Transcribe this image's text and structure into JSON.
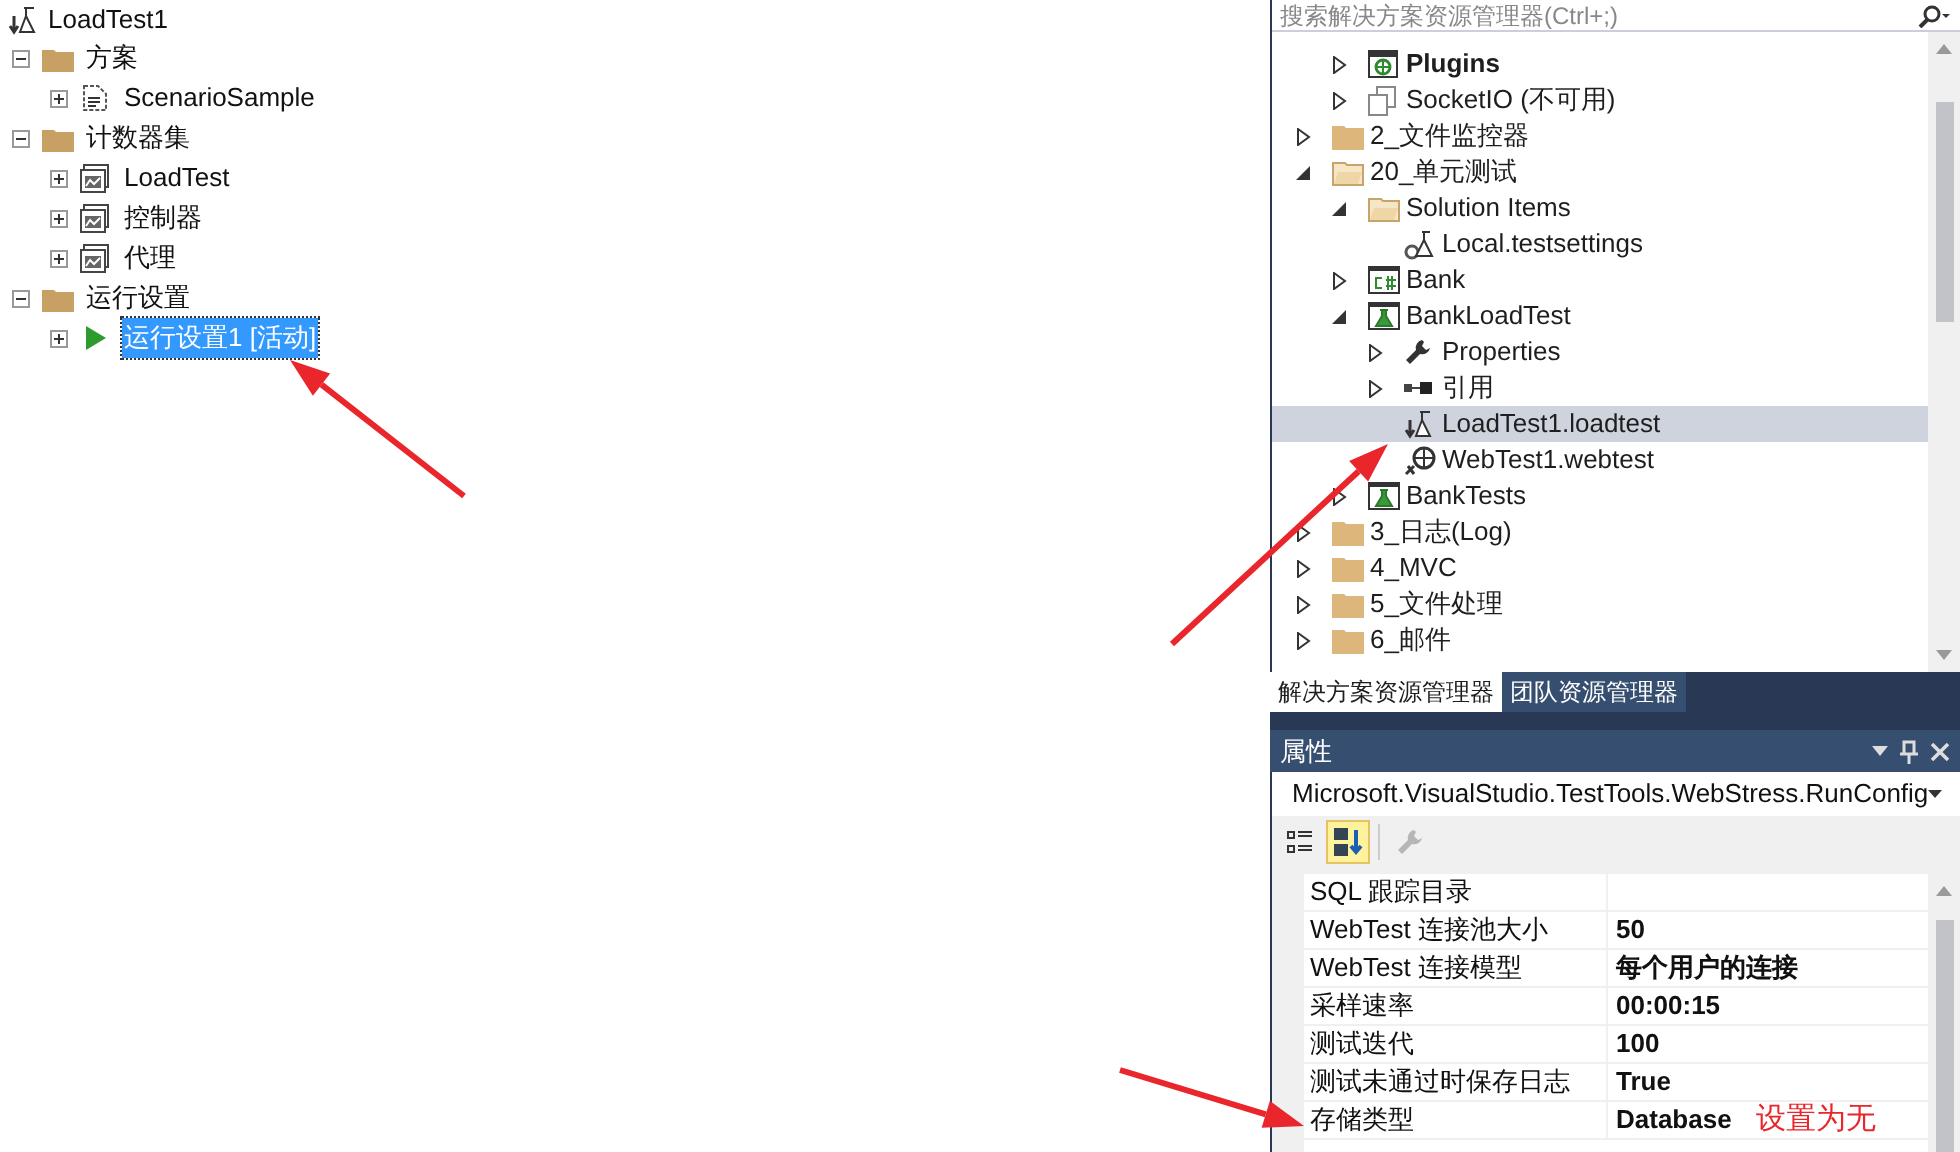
{
  "load_test_tree": {
    "label": "LoadTest1",
    "children": [
      {
        "label": "方案",
        "kind": "folder",
        "expanded": true,
        "children": [
          {
            "label": "ScenarioSample",
            "kind": "scenario",
            "expanded": false,
            "selected": false
          }
        ]
      },
      {
        "label": "计数器集",
        "kind": "folder",
        "expanded": true,
        "children": [
          {
            "label": "LoadTest",
            "kind": "counter",
            "expanded": false,
            "selected": false
          },
          {
            "label": "控制器",
            "kind": "counter",
            "expanded": false,
            "selected": false
          },
          {
            "label": "代理",
            "kind": "counter",
            "expanded": false,
            "selected": false
          }
        ]
      },
      {
        "label": "运行设置",
        "kind": "folder",
        "expanded": true,
        "children": [
          {
            "label": "运行设置1 [活动]",
            "kind": "run",
            "expanded": false,
            "selected": true
          }
        ]
      }
    ]
  },
  "solution_explorer": {
    "search": {
      "placeholder": "搜索解决方案资源管理器(Ctrl+;)"
    },
    "nested_items": [
      {
        "label": "Plugins",
        "kind": "web",
        "expanded": false,
        "bold": true,
        "selected": false
      },
      {
        "label": "SocketIO (不可用)",
        "kind": "unavailable",
        "expanded": false,
        "bold": false,
        "selected": false
      }
    ],
    "items": [
      {
        "label": "2_文件监控器",
        "kind": "folder",
        "expanded": false,
        "bold": false,
        "selected": false
      },
      {
        "label": "20_单元测试",
        "kind": "open-folder",
        "expanded": true,
        "bold": false,
        "selected": false,
        "children": [
          {
            "label": "Solution Items",
            "kind": "open-folder",
            "expanded": true,
            "bold": false,
            "selected": false,
            "children": [
              {
                "label": "Local.testsettings",
                "kind": "settings",
                "bold": false,
                "selected": false
              }
            ]
          },
          {
            "label": "Bank",
            "kind": "csharp",
            "expanded": false,
            "bold": false,
            "selected": false
          },
          {
            "label": "BankLoadTest",
            "kind": "test-project",
            "expanded": true,
            "bold": false,
            "selected": false,
            "children": [
              {
                "label": "Properties",
                "kind": "wrench",
                "expanded": false,
                "bold": false,
                "selected": false
              },
              {
                "label": "引用",
                "kind": "references",
                "expanded": false,
                "bold": false,
                "selected": false
              },
              {
                "label": "LoadTest1.loadtest",
                "kind": "loadtest",
                "bold": false,
                "selected": true
              },
              {
                "label": "WebTest1.webtest",
                "kind": "webtest",
                "bold": false,
                "selected": false
              }
            ]
          },
          {
            "label": "BankTests",
            "kind": "test-project",
            "expanded": false,
            "bold": false,
            "selected": false
          }
        ]
      },
      {
        "label": "3_日志(Log)",
        "kind": "folder",
        "expanded": false,
        "bold": false,
        "selected": false
      },
      {
        "label": "4_MVC",
        "kind": "folder",
        "expanded": false,
        "bold": false,
        "selected": false
      },
      {
        "label": "5_文件处理",
        "kind": "folder",
        "expanded": false,
        "bold": false,
        "selected": false
      },
      {
        "label": "6_邮件",
        "kind": "folder",
        "expanded": false,
        "bold": false,
        "selected": false
      }
    ],
    "tabs": [
      {
        "label": "解决方案资源管理器",
        "selected": true
      },
      {
        "label": "团队资源管理器",
        "selected": false
      }
    ]
  },
  "properties": {
    "title": "属性",
    "object": "Microsoft.VisualStudio.TestTools.WebStress.RunConfig",
    "toolbar": [
      {
        "kind": "categorized",
        "selected": false,
        "disabled": false
      },
      {
        "kind": "alphabetical",
        "selected": true,
        "disabled": false
      },
      {
        "kind": "property-pages",
        "selected": false,
        "disabled": true
      }
    ],
    "rows": [
      {
        "name": "SQL 跟踪目录"
      },
      {
        "name": "WebTest 连接池大小",
        "value": "50"
      },
      {
        "name": "WebTest 连接模型",
        "value": "每个用户的连接"
      },
      {
        "name": "采样速率",
        "value": "00:00:15"
      },
      {
        "name": "测试迭代",
        "value": "100"
      },
      {
        "name": "测试未通过时保存日志",
        "value": "True"
      },
      {
        "name": "存储类型",
        "value": "Database"
      }
    ]
  },
  "annotation": {
    "note": "设置为无"
  }
}
